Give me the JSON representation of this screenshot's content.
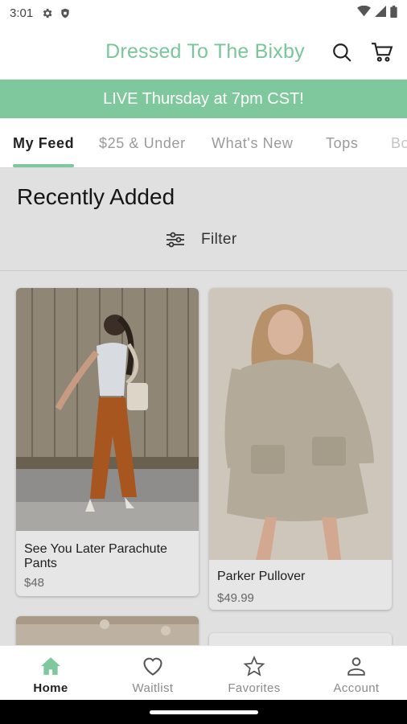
{
  "status_bar": {
    "time": "3:01",
    "icons": [
      "settings-gear-icon",
      "shield-icon",
      "wifi-icon",
      "signal-icon",
      "battery-icon"
    ]
  },
  "header": {
    "title": "Dressed To The Bixby",
    "icons": [
      "search-icon",
      "cart-icon"
    ],
    "accent_color": "#79c69a"
  },
  "announcement": {
    "text": "LIVE Thursday at 7pm CST!",
    "background": "#7fc79c"
  },
  "tabs": [
    {
      "label": "My Feed",
      "active": true
    },
    {
      "label": "$25 & Under",
      "active": false
    },
    {
      "label": "What's New",
      "active": false
    },
    {
      "label": "Tops",
      "active": false
    },
    {
      "label": "Bo",
      "active": false
    }
  ],
  "feed": {
    "section_title": "Recently Added",
    "filter_label": "Filter",
    "products": [
      {
        "name": "See You Later Parachute Pants",
        "price": "$48"
      },
      {
        "name": "Parker Pullover",
        "price": "$49.99"
      }
    ]
  },
  "bottom_nav": [
    {
      "label": "Home",
      "icon": "home-icon",
      "active": true
    },
    {
      "label": "Waitlist",
      "icon": "heart-icon",
      "active": false
    },
    {
      "label": "Favorites",
      "icon": "star-icon",
      "active": false
    },
    {
      "label": "Account",
      "icon": "person-icon",
      "active": false
    }
  ]
}
